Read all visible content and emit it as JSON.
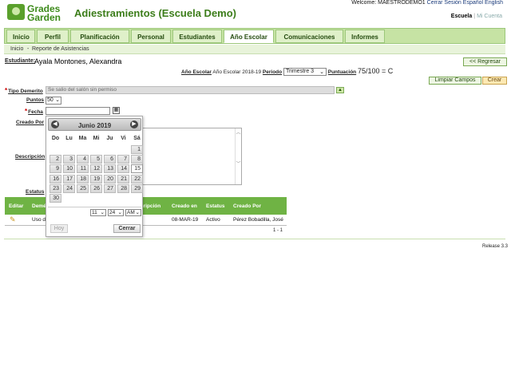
{
  "header": {
    "logo_line1": "Grades",
    "logo_line2": "Garden",
    "title": "Adiestramientos (Escuela Demo)",
    "welcome": "Welcome: MAESTRODEMO1",
    "logout": "Cerrar Sesión",
    "lang_es": "Español",
    "lang_en": "English",
    "school_link": "Escuela",
    "separator": "|",
    "account_link": "Mi Cuenta"
  },
  "nav": {
    "tabs": [
      "Inicio",
      "Perfil",
      "Planificación",
      "Personal",
      "Estudiantes",
      "Año Escolar",
      "Comunicaciones",
      "Informes"
    ],
    "active": "Año Escolar"
  },
  "breadcrumb": {
    "home": "Inicio",
    "sep": "-",
    "current": "Reporte de Asistencias"
  },
  "student": {
    "label": "Estudiante:",
    "name": "Ayala Montones, Alexandra"
  },
  "back_button": "<< Regresar",
  "year_info": {
    "year_label": "Año Escolar",
    "year_value": "Año Escolar 2018-19",
    "period_label": "Periodo",
    "period_value": "Trimestre 3",
    "score_label": "Puntuación",
    "score_value": "75/100 = C"
  },
  "actions": {
    "clear": "Limpiar Campos",
    "create": "Crear"
  },
  "form": {
    "tipo_label": "Tipo Demerito",
    "tipo_value": "Se salio del salón sin permiso",
    "puntos_label": "Puntos",
    "puntos_value": "50",
    "fecha_label": "Fecha",
    "fecha_value": "",
    "creado_label": "Creado Por",
    "desc_label": "Descripción",
    "estatus_label": "Estatus"
  },
  "table": {
    "headers": [
      "Editar",
      "Demérito",
      "Descripción",
      "Creado en",
      "Estatus",
      "Creado Por"
    ],
    "row": {
      "demerito": "Uso de",
      "creado_en": "08-MAR-19",
      "estatus": "Activo",
      "creado_por": "Pérez Bobadilla, José"
    },
    "pager": "1 - 1"
  },
  "release": "Release 3.3",
  "calendar": {
    "title": "Junio 2019",
    "prev": "◀",
    "next": "▶",
    "weekdays": [
      "Do",
      "Lu",
      "Ma",
      "Mi",
      "Ju",
      "Vi",
      "Sá"
    ],
    "first_weekday_index": 6,
    "days_in_month": 30,
    "today": 15,
    "hour": "11",
    "minute": "24",
    "ampm": "AM",
    "today_button": "Hoy",
    "close_button": "Cerrar"
  }
}
